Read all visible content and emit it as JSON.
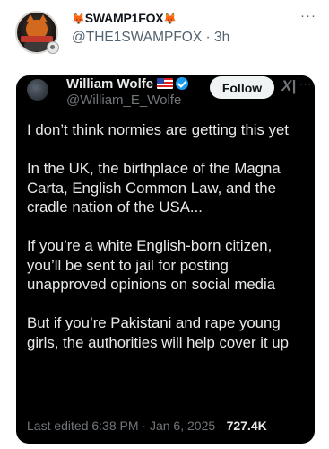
{
  "post": {
    "author": {
      "display_name": "SWAMP1FOX",
      "name_prefix_emoji": "🦊",
      "name_suffix_emoji": "🦊",
      "handle": "@THE1SWAMPFOX",
      "separator": "·",
      "time": "3h"
    },
    "more_label": "···"
  },
  "embedded": {
    "author": {
      "display_name": "William Wolfe",
      "handle": "@William_E_Wolfe"
    },
    "follow_label": "Follow",
    "grok_glyph": "X|",
    "more_label": "···",
    "paragraphs": [
      "I don’t think normies are getting this yet",
      "In the UK, the birthplace of the Magna Carta, English Common Law, and the cradle nation of the USA...",
      "If you’re a white English-born citizen, you’ll be sent to jail for posting unapproved opinions on social media",
      "But if you’re Pakistani and rape young girls, the authorities will help cover it up"
    ],
    "meta": {
      "edited_text": "Last edited 6:38 PM · Jan 6, 2025 · ",
      "views": "727.4K"
    }
  },
  "colors": {
    "accent_blue": "#1d9bf0",
    "text_dark": "#0f1419",
    "text_muted": "#536471",
    "embed_bg": "#000000"
  }
}
